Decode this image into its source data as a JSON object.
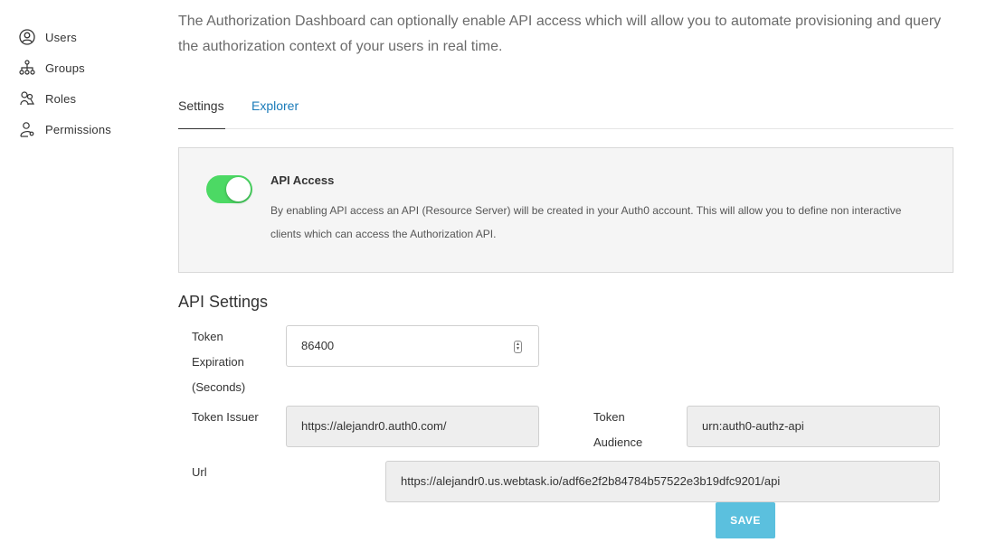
{
  "sidebar": {
    "items": [
      {
        "label": "Users",
        "icon": "user-circle-icon"
      },
      {
        "label": "Groups",
        "icon": "hierarchy-icon"
      },
      {
        "label": "Roles",
        "icon": "roles-icon"
      },
      {
        "label": "Permissions",
        "icon": "person-key-icon"
      }
    ]
  },
  "intro": "The Authorization Dashboard can optionally enable API access which will allow you to automate provisioning and query the authorization context of your users in real time.",
  "tabs": [
    {
      "label": "Settings",
      "active": true
    },
    {
      "label": "Explorer",
      "active": false
    }
  ],
  "api_access": {
    "title": "API Access",
    "description": "By enabling API access an API (Resource Server) will be created in your Auth0 account. This will allow you to define non interactive clients which can access the Authorization API.",
    "enabled": true,
    "toggle_color": "#4cd964"
  },
  "api_settings": {
    "title": "API Settings",
    "token_expiration": {
      "label": "Token Expiration (Seconds)",
      "value": "86400"
    },
    "token_issuer": {
      "label": "Token Issuer",
      "value": "https://alejandr0.auth0.com/"
    },
    "token_audience": {
      "label": "Token Audience",
      "value": "urn:auth0-authz-api"
    },
    "url": {
      "label": "Url",
      "value": "https://alejandr0.us.webtask.io/adf6e2f2b84784b57522e3b19dfc9201/api"
    }
  },
  "save_button": {
    "label": "SAVE",
    "color": "#5bc0de"
  },
  "colors": {
    "link": "#1a7bb9"
  }
}
